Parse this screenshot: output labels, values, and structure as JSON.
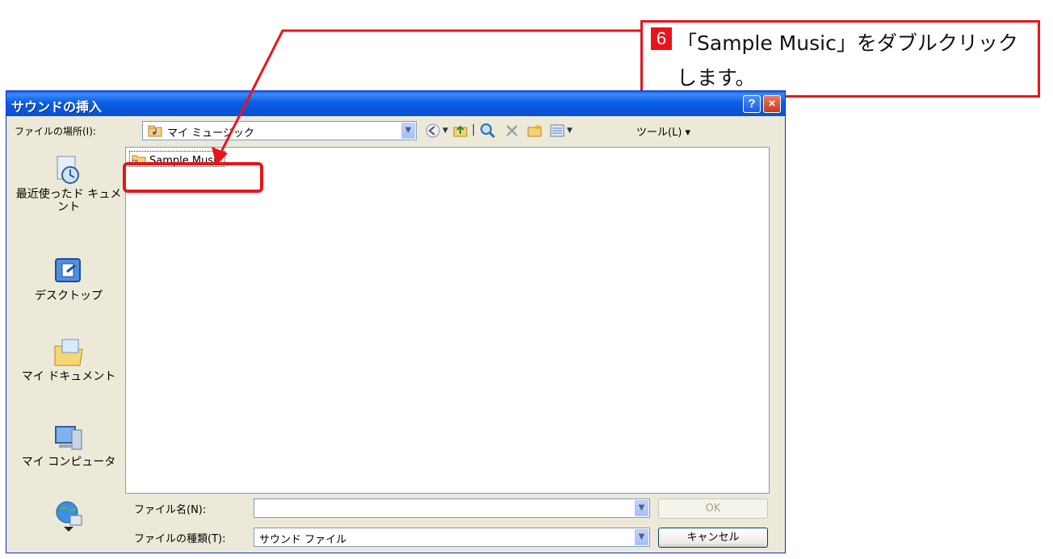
{
  "callout": {
    "step": "6",
    "text": "「Sample Music」をダブルクリックします。"
  },
  "dialog": {
    "title": "サウンドの挿入",
    "help_button": "?",
    "close_button": "×",
    "lookin_label": "ファイルの場所(I):",
    "lookin_value": "マイ ミュージック",
    "tools_label": "ツール(L) ▾"
  },
  "places": [
    {
      "label": "最近使ったド キュメント",
      "icon": "recent-documents-icon"
    },
    {
      "label": "デスクトップ",
      "icon": "desktop-icon"
    },
    {
      "label": "マイ ドキュメント",
      "icon": "my-documents-icon"
    },
    {
      "label": "マイ コンピュータ",
      "icon": "my-computer-icon"
    },
    {
      "label": "",
      "icon": "network-places-icon"
    }
  ],
  "files": [
    {
      "name": "Sample Music",
      "icon": "folder-shortcut-icon"
    }
  ],
  "filename": {
    "label": "ファイル名(N):",
    "value": ""
  },
  "filetype": {
    "label": "ファイルの種類(T):",
    "value": "サウンド ファイル"
  },
  "buttons": {
    "ok": "OK",
    "cancel": "キャンセル"
  },
  "colors": {
    "accent_red": "#e8141b",
    "titlebar_blue": "#0a5fe6"
  }
}
